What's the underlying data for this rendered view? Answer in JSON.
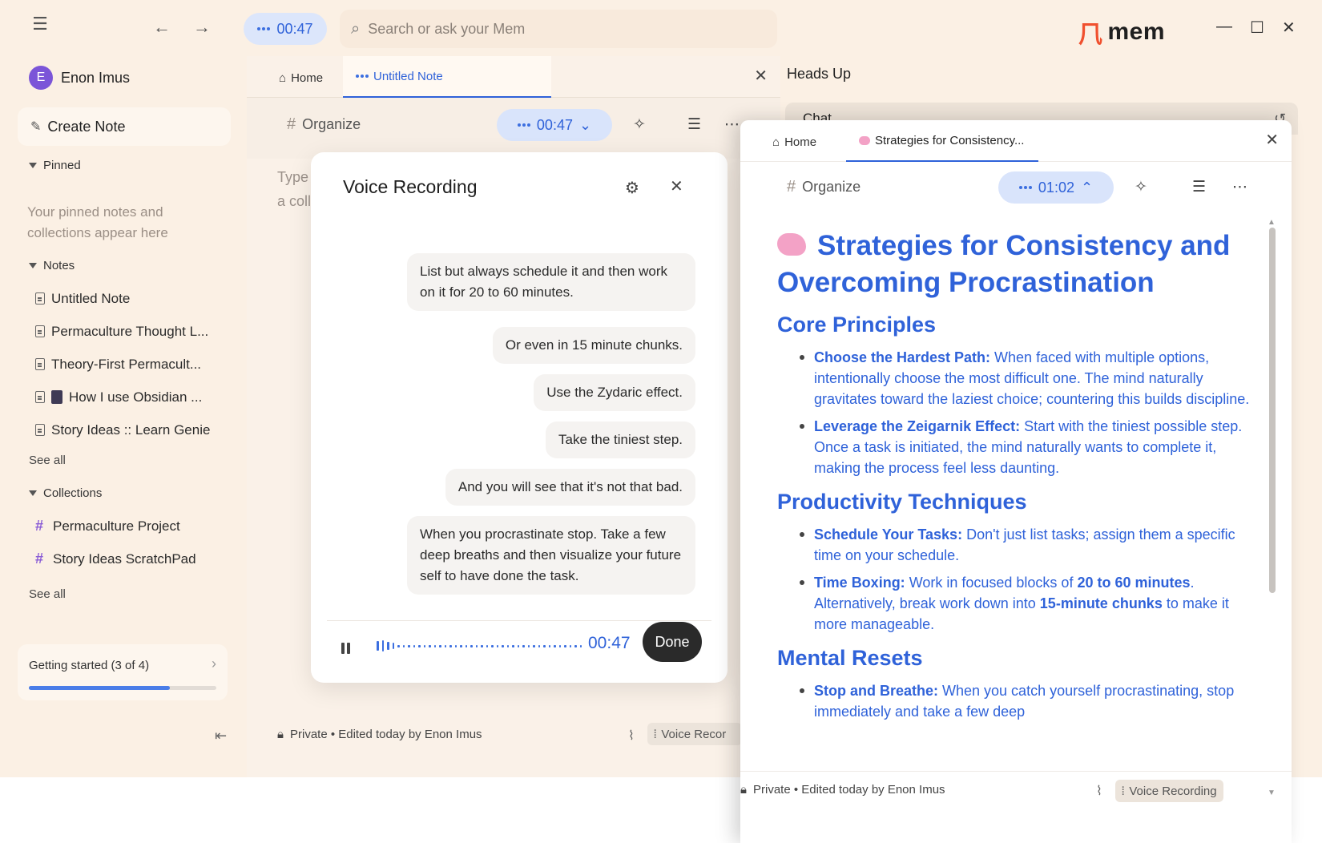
{
  "topbar": {
    "timer": "00:47",
    "search_placeholder": "Search or ask your Mem",
    "logo_text": "mem",
    "logo_mark": "⺇"
  },
  "sidebar": {
    "user_initial": "E",
    "user_name": "Enon Imus",
    "create_note": "Create Note",
    "pinned_heading": "Pinned",
    "pinned_empty": "Your pinned notes and collections appear here",
    "notes_heading": "Notes",
    "notes": [
      {
        "label": "Untitled Note"
      },
      {
        "label": "Permaculture Thought L..."
      },
      {
        "label": "Theory-First Permacult..."
      },
      {
        "label": "How I use Obsidian ..."
      },
      {
        "label": "Story Ideas :: Learn Genie"
      }
    ],
    "notes_see_all": "See all",
    "collections_heading": "Collections",
    "collections": [
      {
        "label": "Permaculture Project"
      },
      {
        "label": "Story Ideas ScratchPad"
      }
    ],
    "collections_see_all": "See all",
    "getting_started": "Getting started (3 of 4)",
    "getting_started_progress": 0.75
  },
  "center": {
    "tab_home": "Home",
    "tab_active": "Untitled Note",
    "organize": "Organize",
    "timer": "00:47",
    "type_hint_1": "Type",
    "type_hint_2": "a collec",
    "footer_meta": "Private • Edited today by Enon Imus",
    "voice_chip": "Voice Recor"
  },
  "voice_modal": {
    "title": "Voice Recording",
    "bubbles": [
      "List but always schedule it and then work on it for 20 to 60 minutes.",
      "Or even in 15 minute chunks.",
      "Use the Zydaric effect.",
      "Take the tiniest step.",
      "And you will see that it's not that bad.",
      "When you procrastinate stop. Take a few deep breaths and then visualize your future self to have done the task."
    ],
    "time": "00:47",
    "done": "Done"
  },
  "right": {
    "heads_up": "Heads Up",
    "chat_peek": "Chat"
  },
  "float": {
    "tab_home": "Home",
    "tab_active": "Strategies for Consistency...",
    "organize": "Organize",
    "timer": "01:02",
    "title": "Strategies for Consistency and Overcoming Procrastination",
    "sections": [
      {
        "heading": "Core Principles",
        "items": [
          {
            "bold": "Choose the Hardest Path:",
            "text": " When faced with multiple options, intentionally choose the most difficult one. The mind naturally gravitates toward the laziest choice; countering this builds discipline."
          },
          {
            "bold": "Leverage the Zeigarnik Effect:",
            "text": " Start with the tiniest possible step. Once a task is initiated, the mind naturally wants to complete it, making the process feel less daunting."
          }
        ]
      },
      {
        "heading": "Productivity Techniques",
        "items": [
          {
            "bold": "Schedule Your Tasks:",
            "text": " Don't just list tasks; assign them a specific time on your schedule."
          },
          {
            "bold": "Time Boxing:",
            "text": " Work in focused blocks of ",
            "bold2": "20 to 60 minutes",
            "text2": ". Alternatively, break work down into ",
            "bold3": "15-minute chunks",
            "text3": " to make it more manageable."
          }
        ]
      },
      {
        "heading": "Mental Resets",
        "items": [
          {
            "bold": "Stop and Breathe:",
            "text": " When you catch yourself procrastinating, stop immediately and take a few deep"
          }
        ]
      }
    ],
    "footer_meta": "Private • Edited today by Enon Imus",
    "voice_chip": "Voice Recording"
  }
}
